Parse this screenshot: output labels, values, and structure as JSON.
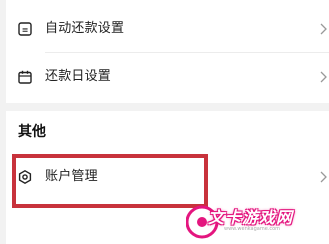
{
  "settings_card": {
    "items": [
      {
        "label": "自动还款设置",
        "icon": "auto-repay-icon"
      },
      {
        "label": "还款日设置",
        "icon": "calendar-icon"
      }
    ]
  },
  "other_section": {
    "title": "其他",
    "items": [
      {
        "label": "账户管理",
        "icon": "gear-icon"
      }
    ]
  },
  "highlight": {
    "color": "#c8323c"
  },
  "watermark": {
    "text": "文卡游戏网",
    "url": "www.wenkagame.com",
    "color": "#e4167f"
  }
}
